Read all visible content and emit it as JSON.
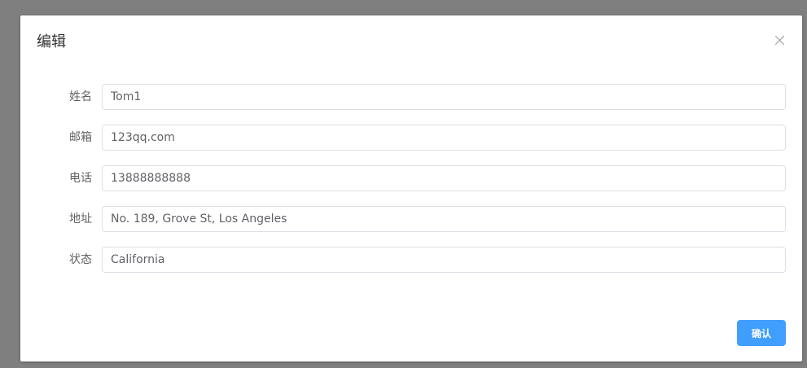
{
  "dialog": {
    "title": "编辑",
    "confirm_label": "确认"
  },
  "form": {
    "fields": [
      {
        "label": "姓名",
        "value": "Tom1"
      },
      {
        "label": "邮箱",
        "value": "123qq.com"
      },
      {
        "label": "电话",
        "value": "13888888888"
      },
      {
        "label": "地址",
        "value": "No. 189, Grove St, Los Angeles"
      },
      {
        "label": "状态",
        "value": "California"
      }
    ]
  },
  "colors": {
    "accent": "#409eff",
    "overlay": "#7f7f7f"
  }
}
